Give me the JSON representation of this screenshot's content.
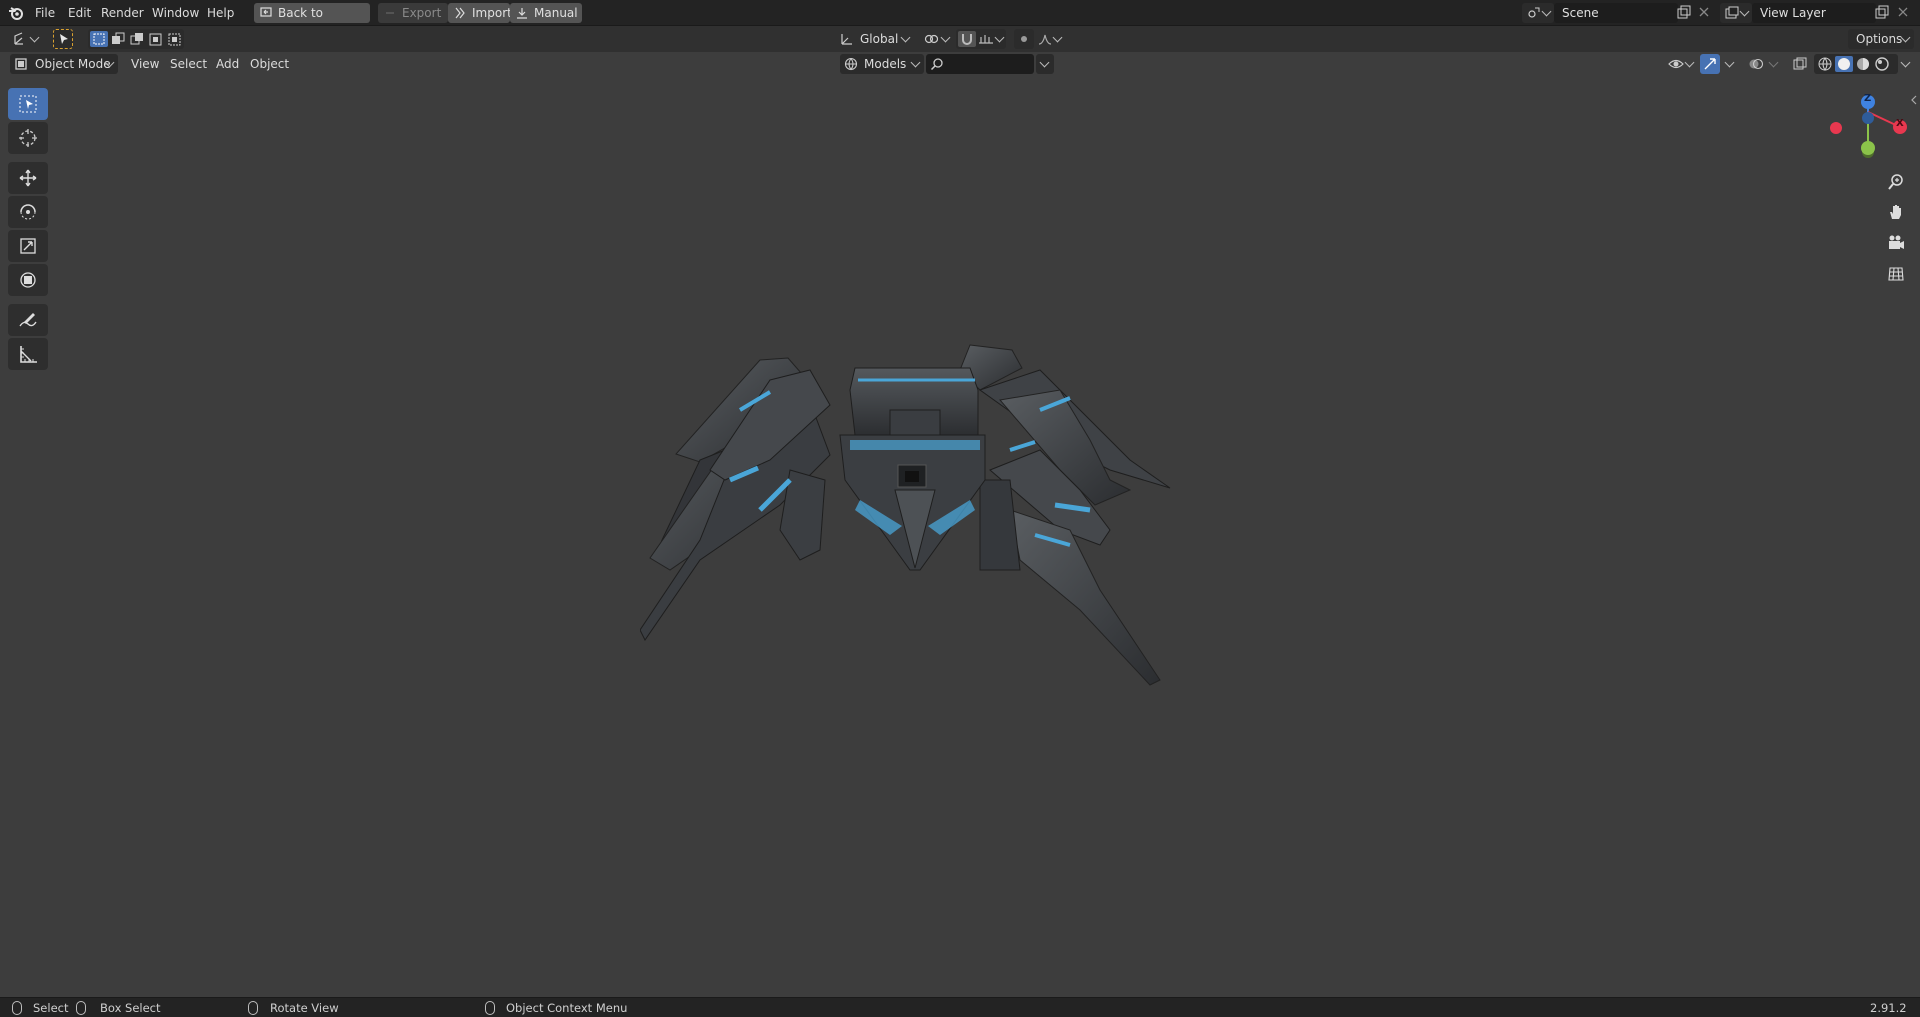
{
  "menubar": {
    "items": [
      "File",
      "Edit",
      "Render",
      "Window",
      "Help"
    ],
    "back_label": "Back to Previous",
    "export_label": "Export",
    "import_label": "Import",
    "manual_label": "Manual",
    "scene_label": "Scene",
    "view_layer_label": "View Layer"
  },
  "toolheader": {
    "transform_orientation": "Global",
    "options_label": "Options"
  },
  "viewheader": {
    "mode": "Object Mode",
    "menus": [
      "View",
      "Select",
      "Add",
      "Object"
    ],
    "collection": "Models",
    "search_placeholder": ""
  },
  "toolbar": {
    "tools": [
      "select-box-tool",
      "cursor-tool",
      "move-tool",
      "rotate-tool",
      "scale-tool",
      "transform-tool",
      "annotate-tool",
      "measure-tool"
    ]
  },
  "gizmo": {
    "axis_labels": [
      "Z",
      "X",
      "Y"
    ],
    "x_color": "#e8384f",
    "y_color": "#8bc34a",
    "z_color": "#3f82e0"
  },
  "statusbar": {
    "select": "Select",
    "box_select": "Box Select",
    "rotate_view": "Rotate View",
    "context_menu": "Object Context Menu",
    "version": "2.91.2"
  },
  "colors": {
    "accent": "#4772b3",
    "viewport_bg": "#3d3d3d",
    "model_glow": "#4aa6d8"
  }
}
